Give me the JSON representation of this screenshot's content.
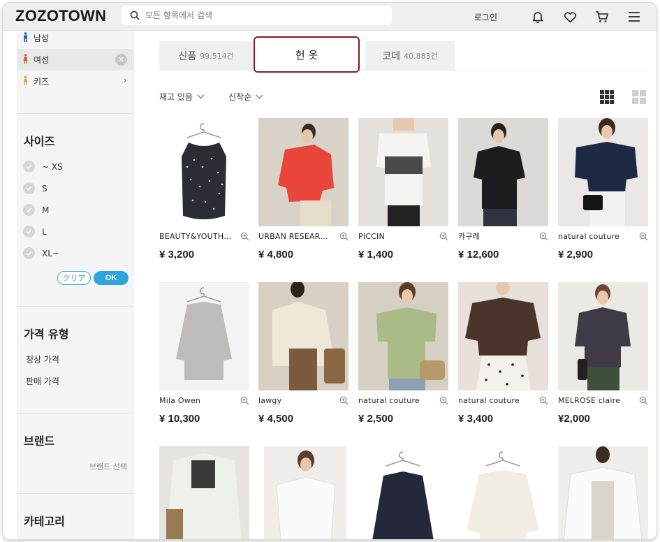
{
  "header": {
    "logo": "ZOZOTOWN",
    "search_placeholder": "모든 항목에서 검색",
    "login_label": "로그인",
    "icons": [
      "search-icon",
      "bell-icon",
      "heart-icon",
      "cart-icon",
      "menu-icon"
    ]
  },
  "sidebar": {
    "genders": [
      {
        "label": "남성",
        "color": "#1a62c4",
        "active": false
      },
      {
        "label": "여성",
        "color": "#e05a4a",
        "active": true
      },
      {
        "label": "키즈",
        "color": "#e8a82c",
        "active": false
      }
    ],
    "size_title": "사이즈",
    "sizes": [
      "~ XS",
      "S",
      "M",
      "L",
      "XL~"
    ],
    "clear_label": "クリア",
    "ok_label": "OK",
    "price_title": "가격 유형",
    "price_types": [
      "정상 가격",
      "판매 가격"
    ],
    "brand_title": "브랜드",
    "brand_select": "브랜드 선택",
    "category_title": "카테고리"
  },
  "tabs": [
    {
      "label": "신품",
      "count": "99,514건",
      "active": false
    },
    {
      "label": "헌 옷",
      "count": "",
      "active": true
    },
    {
      "label": "코데",
      "count": "40,883건",
      "active": false
    }
  ],
  "filters": {
    "stock": "재고 있음",
    "sort": "신착순"
  },
  "colors": {
    "accent_blue": "#2ea6dc",
    "active_tab_border": "#8b1a1a"
  },
  "products": [
    {
      "brand": "BEAUTY&YOUTH…",
      "price": "¥ 3,200"
    },
    {
      "brand": "URBAN RESEAR…",
      "price": "¥ 4,800"
    },
    {
      "brand": "PICCIN",
      "price": "¥ 1,400"
    },
    {
      "brand": "카구레",
      "price": "¥ 12,600"
    },
    {
      "brand": "natural couture",
      "price": "¥ 2,900"
    },
    {
      "brand": "Mila Owen",
      "price": "¥ 10,300"
    },
    {
      "brand": "lawgy",
      "price": "¥ 4,500"
    },
    {
      "brand": "natural couture",
      "price": "¥ 2,500"
    },
    {
      "brand": "natural couture",
      "price": "¥ 3,400"
    },
    {
      "brand": "MELROSE claire",
      "price": "¥2,000"
    }
  ]
}
